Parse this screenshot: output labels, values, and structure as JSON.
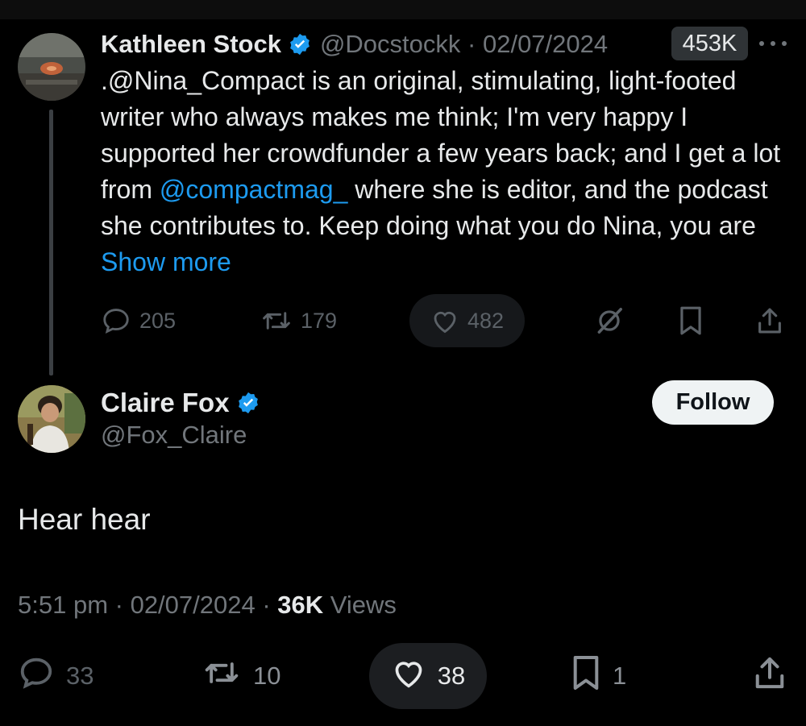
{
  "parent_tweet": {
    "author_name": "Kathleen Stock",
    "handle": "@Docstockk",
    "date": "02/07/2024",
    "views": "453K",
    "text_before_mention": ".@Nina_Compact is an original, stimulating, light-footed writer who always makes me think;  I'm very happy I supported her crowdfunder a few years back; and I get a lot from ",
    "mention": "@compactmag_",
    "text_after_mention": " where she is editor, and the podcast she contributes to. Keep doing what you do Nina, you are ",
    "show_more": "Show more",
    "replies": "205",
    "retweets": "179",
    "likes": "482"
  },
  "reply_tweet": {
    "author_name": "Claire Fox",
    "handle": "@Fox_Claire",
    "follow_label": "Follow",
    "text": "Hear hear",
    "time": "5:51 pm",
    "date": "02/07/2024",
    "views_count": "36K",
    "views_label": "Views",
    "replies": "33",
    "retweets": "10",
    "likes": "38",
    "bookmarks": "1"
  },
  "colors": {
    "background": "#000000",
    "text": "#e7e9ea",
    "secondary": "#71767b",
    "link": "#1d9bf0",
    "verified": "#1d9bf0"
  }
}
